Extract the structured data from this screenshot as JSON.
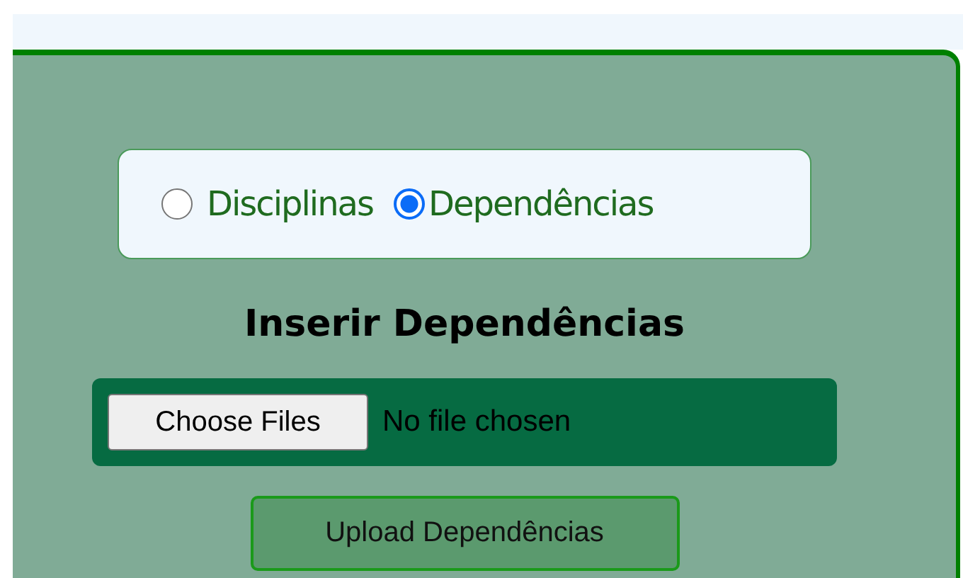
{
  "mode_selector": {
    "options": [
      {
        "label": "Disciplinas",
        "selected": false
      },
      {
        "label": "Dependências",
        "selected": true
      }
    ]
  },
  "heading": "Inserir Dependências",
  "file_picker": {
    "button": "Choose Files",
    "status": "No file chosen"
  },
  "upload_button": "Upload Dependências"
}
